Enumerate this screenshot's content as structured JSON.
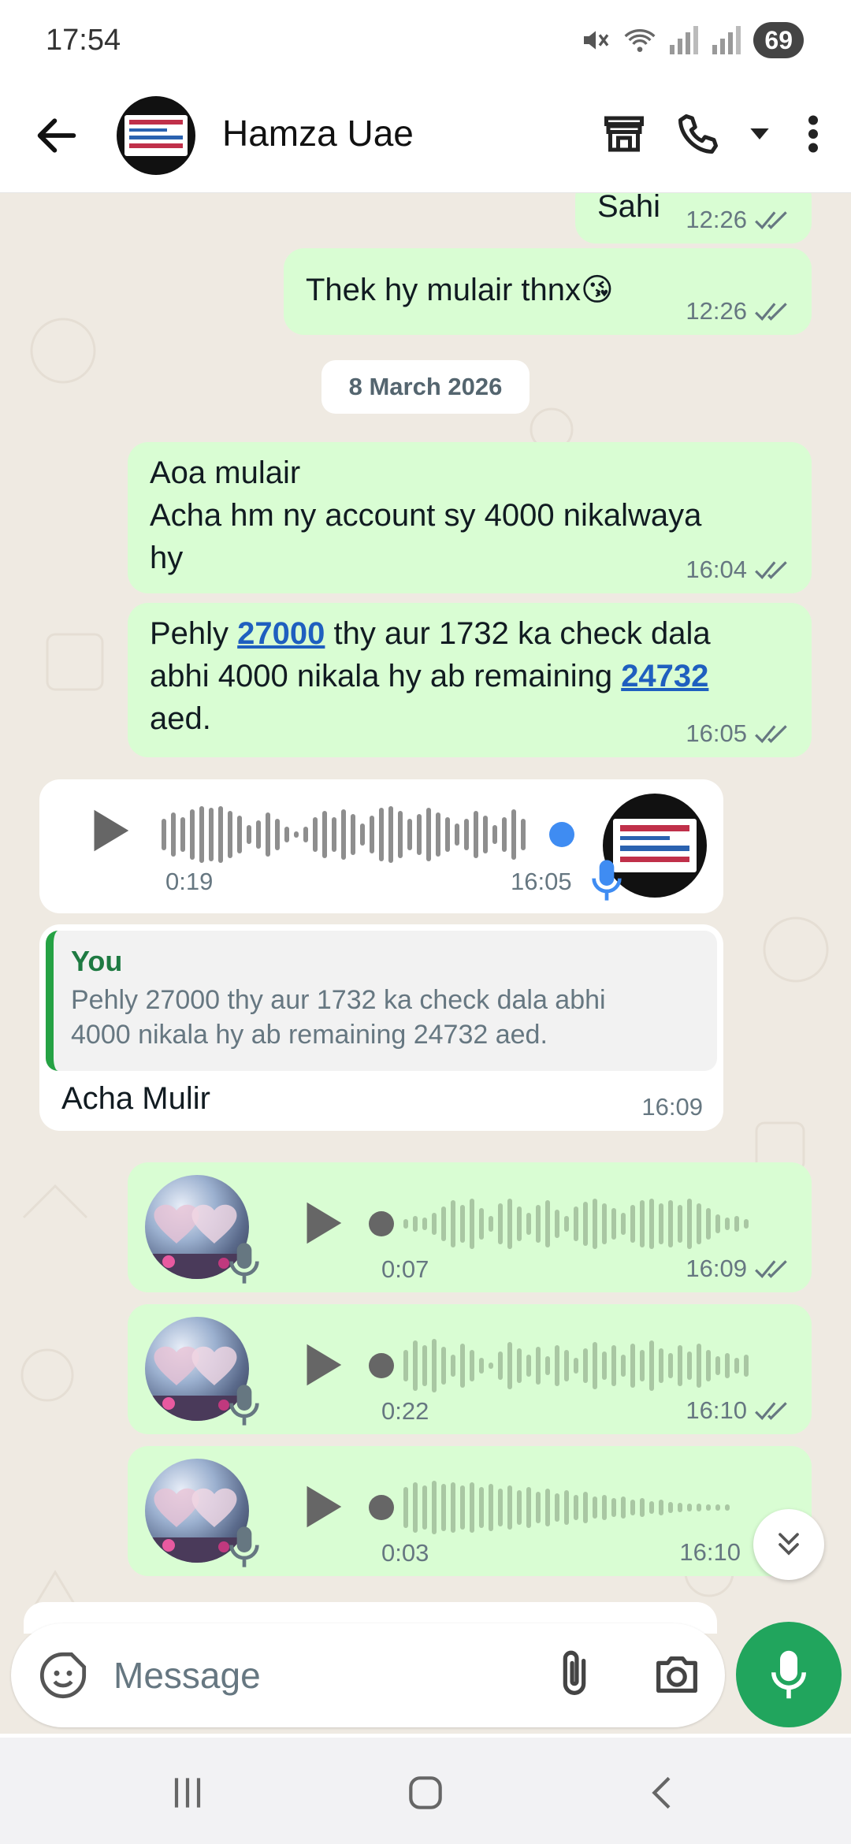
{
  "status": {
    "time": "17:54",
    "battery": "69",
    "signal_label": "5"
  },
  "header": {
    "contact_name": "Hamza Uae"
  },
  "messages": {
    "m0": {
      "text": "Sahi",
      "time": "12:26"
    },
    "m1": {
      "text": "Thek hy mulair thnx😘",
      "time": "12:26"
    },
    "date_chip": "8 March 2026",
    "m2": {
      "lines": [
        "Aoa mulair",
        "Acha hm ny account sy 4000 nikalwaya",
        "hy"
      ],
      "time": "16:04"
    },
    "m3": {
      "p1": "Pehly ",
      "link1": "27000",
      "p2": " thy aur 1732 ka check dala",
      "p3": "abhi 4000 nikala hy ab remaining ",
      "link2": "24732",
      "p4": "aed.",
      "time": "16:05"
    },
    "voice_in": {
      "duration": "0:19",
      "time": "16:05"
    },
    "reply": {
      "quoted_author": "You",
      "quoted_lines": [
        "Pehly 27000 thy aur 1732 ka check dala abhi",
        "4000 nikala hy ab remaining 24732 aed."
      ],
      "text": "Acha Mulir",
      "time": "16:09"
    },
    "voice_out": [
      {
        "duration": "0:07",
        "time": "16:09"
      },
      {
        "duration": "0:22",
        "time": "16:10"
      },
      {
        "duration": "0:03",
        "time": "16:10"
      }
    ]
  },
  "composer": {
    "placeholder": "Message"
  },
  "colors": {
    "outgoing": "#d9fdd3",
    "incoming": "#ffffff",
    "accent": "#21a55d",
    "link": "#1f5fbf",
    "wallpaper": "#efeae2"
  },
  "icons": [
    "back-arrow-icon",
    "store-icon",
    "phone-icon",
    "dropdown-icon",
    "more-vert-icon",
    "play-icon",
    "mic-icon",
    "double-check-icon",
    "sticker-icon",
    "attach-icon",
    "camera-icon",
    "scroll-down-icon",
    "recents-icon",
    "home-icon",
    "nav-back-icon"
  ]
}
